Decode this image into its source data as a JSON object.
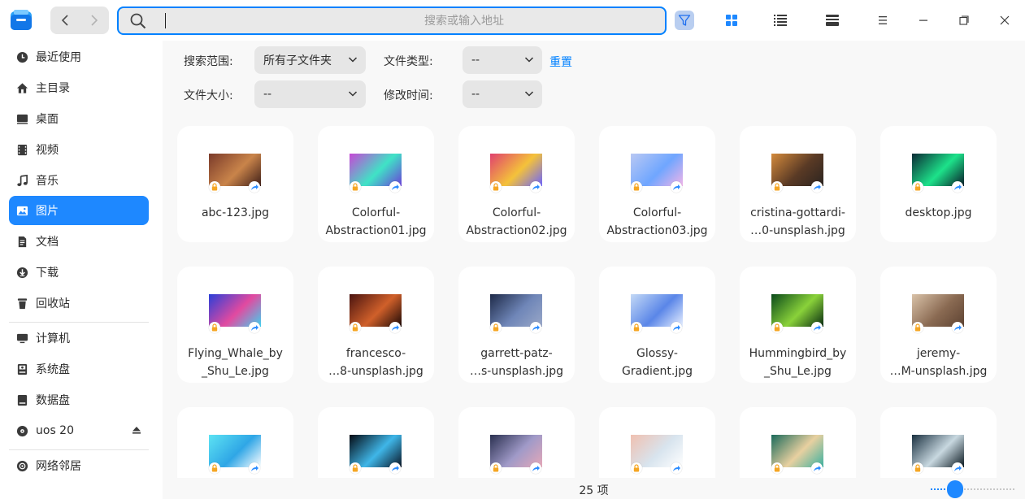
{
  "toolbar": {
    "back_icon": "chevron-left",
    "forward_icon": "chevron-right",
    "search_placeholder": "搜索或输入地址"
  },
  "sidebar": {
    "items": [
      {
        "label": "最近使用",
        "icon": "clock-icon"
      },
      {
        "label": "主目录",
        "icon": "home-icon"
      },
      {
        "label": "桌面",
        "icon": "desktop-icon"
      },
      {
        "label": "视频",
        "icon": "video-icon"
      },
      {
        "label": "音乐",
        "icon": "music-icon"
      },
      {
        "label": "图片",
        "icon": "picture-icon",
        "active": true
      },
      {
        "label": "文档",
        "icon": "document-icon"
      },
      {
        "label": "下载",
        "icon": "download-icon"
      },
      {
        "label": "回收站",
        "icon": "trash-icon"
      }
    ],
    "devices": [
      {
        "label": "计算机",
        "icon": "computer-icon"
      },
      {
        "label": "系统盘",
        "icon": "disk-icon"
      },
      {
        "label": "数据盘",
        "icon": "disk-icon"
      },
      {
        "label": "uos 20",
        "icon": "optical-disc-icon"
      }
    ],
    "network": {
      "label": "网络邻居",
      "icon": "network-icon"
    }
  },
  "filters": {
    "scope_label": "搜索范围:",
    "scope_value": "所有子文件夹",
    "type_label": "文件类型:",
    "type_value": "--",
    "reset_label": "重置",
    "size_label": "文件大小:",
    "size_value": "--",
    "mtime_label": "修改时间:",
    "mtime_value": "--"
  },
  "files": [
    {
      "name": [
        "abc-123.jpg"
      ],
      "thumb": [
        "#7a3a2a",
        "#c9844a",
        "#3d1e18"
      ]
    },
    {
      "name": [
        "Colorful-",
        "Abstraction01.jpg"
      ],
      "thumb": [
        "#c846d6",
        "#3fe3c6",
        "#6a3fd8"
      ]
    },
    {
      "name": [
        "Colorful-",
        "Abstraction02.jpg"
      ],
      "thumb": [
        "#e0406f",
        "#f4c23a",
        "#6b63ff"
      ]
    },
    {
      "name": [
        "Colorful-",
        "Abstraction03.jpg"
      ],
      "thumb": [
        "#b9c8f3",
        "#6fa6ff",
        "#f1b4e8"
      ]
    },
    {
      "name": [
        "cristina-gottardi-",
        "…0-unsplash.jpg"
      ],
      "thumb": [
        "#d48a3c",
        "#5a3a25",
        "#2a2420"
      ]
    },
    {
      "name": [
        "desktop.jpg"
      ],
      "thumb": [
        "#0b2a35",
        "#1de28a",
        "#0a1a28"
      ]
    },
    {
      "name": [
        "Flying_Whale_by",
        "_Shu_Le.jpg"
      ],
      "thumb": [
        "#2a3fd8",
        "#e24aa0",
        "#3fd2f0"
      ]
    },
    {
      "name": [
        "francesco-",
        "…8-unsplash.jpg"
      ],
      "thumb": [
        "#4a1410",
        "#d0602a",
        "#1a0806"
      ]
    },
    {
      "name": [
        "garrett-patz-",
        "…s-unsplash.jpg"
      ],
      "thumb": [
        "#1e2a48",
        "#6f86b8",
        "#9aa8c8"
      ]
    },
    {
      "name": [
        "Glossy-",
        "Gradient.jpg"
      ],
      "thumb": [
        "#c4d9f6",
        "#5a86e8",
        "#e8f0ff"
      ]
    },
    {
      "name": [
        "Hummingbird_by",
        "_Shu_Le.jpg"
      ],
      "thumb": [
        "#0a4a1a",
        "#8ad23a",
        "#062a10"
      ]
    },
    {
      "name": [
        "jeremy-",
        "…M-unsplash.jpg"
      ],
      "thumb": [
        "#d9c2a8",
        "#8a6a52",
        "#5c4232"
      ]
    },
    {
      "name": [
        ""
      ],
      "thumb": [
        "#5de3f3",
        "#2fa6e6",
        "#ffffff"
      ]
    },
    {
      "name": [
        ""
      ],
      "thumb": [
        "#050a12",
        "#3fb6e8",
        "#0a1424"
      ]
    },
    {
      "name": [
        ""
      ],
      "thumb": [
        "#2a3050",
        "#a09ac8",
        "#e6a8b8"
      ]
    },
    {
      "name": [
        ""
      ],
      "thumb": [
        "#f0c0b0",
        "#d8e4ee",
        "#ffffff"
      ]
    },
    {
      "name": [
        ""
      ],
      "thumb": [
        "#1a6a5a",
        "#e8d0a0",
        "#3ab0a0"
      ]
    },
    {
      "name": [
        ""
      ],
      "thumb": [
        "#1a3040",
        "#c8d8e0",
        "#0a1820"
      ]
    }
  ],
  "status": {
    "count": "25 项",
    "zoom_fraction": 0.24
  },
  "colors": {
    "accent": "#1e88ff",
    "lock_badge": "#f5a623",
    "share_badge": "#2b8cff"
  }
}
